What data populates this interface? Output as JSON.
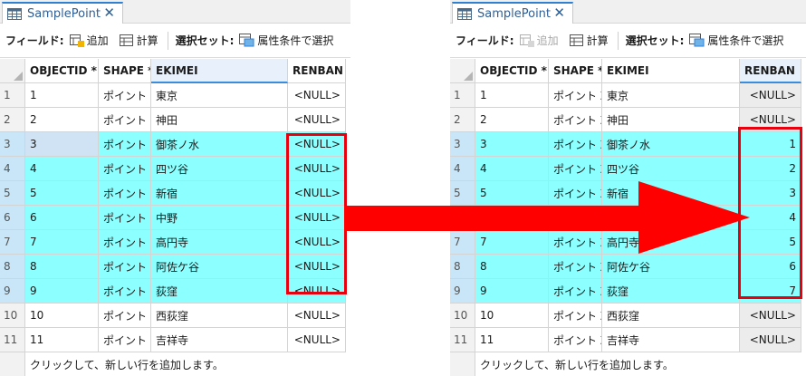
{
  "tab": {
    "title": "SamplePoint",
    "close": "✕"
  },
  "toolbar": {
    "field_label": "フィールド:",
    "add_label": "追加",
    "calc_label": "計算",
    "selset_label": "選択セット:",
    "attr_select_label": "属性条件で選択"
  },
  "columns": {
    "objectid": "OBJECTID *",
    "shape": "SHAPE *",
    "ekimei": "EKIMEI",
    "renban": "RENBAN"
  },
  "footer_text": "クリックして、新しい行を追加します。",
  "left_rows": [
    {
      "rn": "1",
      "objectid": "1",
      "shape": "ポイント Z",
      "ekimei": "東京",
      "renban": "<NULL>"
    },
    {
      "rn": "2",
      "objectid": "2",
      "shape": "ポイント Z",
      "ekimei": "神田",
      "renban": "<NULL>"
    },
    {
      "rn": "3",
      "objectid": "3",
      "shape": "ポイント Z",
      "ekimei": "御茶ノ水",
      "renban": "<NULL>"
    },
    {
      "rn": "4",
      "objectid": "4",
      "shape": "ポイント Z",
      "ekimei": "四ツ谷",
      "renban": "<NULL>"
    },
    {
      "rn": "5",
      "objectid": "5",
      "shape": "ポイント Z",
      "ekimei": "新宿",
      "renban": "<NULL>"
    },
    {
      "rn": "6",
      "objectid": "6",
      "shape": "ポイント Z",
      "ekimei": "中野",
      "renban": "<NULL>"
    },
    {
      "rn": "7",
      "objectid": "7",
      "shape": "ポイント Z",
      "ekimei": "高円寺",
      "renban": "<NULL>"
    },
    {
      "rn": "8",
      "objectid": "8",
      "shape": "ポイント Z",
      "ekimei": "阿佐ケ谷",
      "renban": "<NULL>"
    },
    {
      "rn": "9",
      "objectid": "9",
      "shape": "ポイント Z",
      "ekimei": "荻窪",
      "renban": "<NULL>"
    },
    {
      "rn": "10",
      "objectid": "10",
      "shape": "ポイント Z",
      "ekimei": "西荻窪",
      "renban": "<NULL>"
    },
    {
      "rn": "11",
      "objectid": "11",
      "shape": "ポイント Z",
      "ekimei": "吉祥寺",
      "renban": "<NULL>"
    }
  ],
  "right_rows": [
    {
      "rn": "1",
      "objectid": "1",
      "shape": "ポイント Z",
      "ekimei": "東京",
      "renban": "<NULL>"
    },
    {
      "rn": "2",
      "objectid": "2",
      "shape": "ポイント Z",
      "ekimei": "神田",
      "renban": "<NULL>"
    },
    {
      "rn": "3",
      "objectid": "3",
      "shape": "ポイント Z",
      "ekimei": "御茶ノ水",
      "renban": "1"
    },
    {
      "rn": "4",
      "objectid": "4",
      "shape": "ポイント Z",
      "ekimei": "四ツ谷",
      "renban": "2"
    },
    {
      "rn": "5",
      "objectid": "5",
      "shape": "ポイント Z",
      "ekimei": "新宿",
      "renban": "3"
    },
    {
      "rn": "",
      "objectid": "",
      "shape": "",
      "ekimei": "",
      "renban": "4"
    },
    {
      "rn": "7",
      "objectid": "7",
      "shape": "ポイント Z",
      "ekimei": "高円寺",
      "renban": "5"
    },
    {
      "rn": "8",
      "objectid": "8",
      "shape": "ポイント Z",
      "ekimei": "阿佐ケ谷",
      "renban": "6"
    },
    {
      "rn": "9",
      "objectid": "9",
      "shape": "ポイント Z",
      "ekimei": "荻窪",
      "renban": "7"
    },
    {
      "rn": "10",
      "objectid": "10",
      "shape": "ポイント Z",
      "ekimei": "西荻窪",
      "renban": "<NULL>"
    },
    {
      "rn": "11",
      "objectid": "11",
      "shape": "ポイント Z",
      "ekimei": "吉祥寺",
      "renban": "<NULL>"
    }
  ],
  "colors": {
    "selected_row": "#8cffff",
    "highlight": "#e8000f",
    "tab_accent": "#2f7fd3"
  }
}
